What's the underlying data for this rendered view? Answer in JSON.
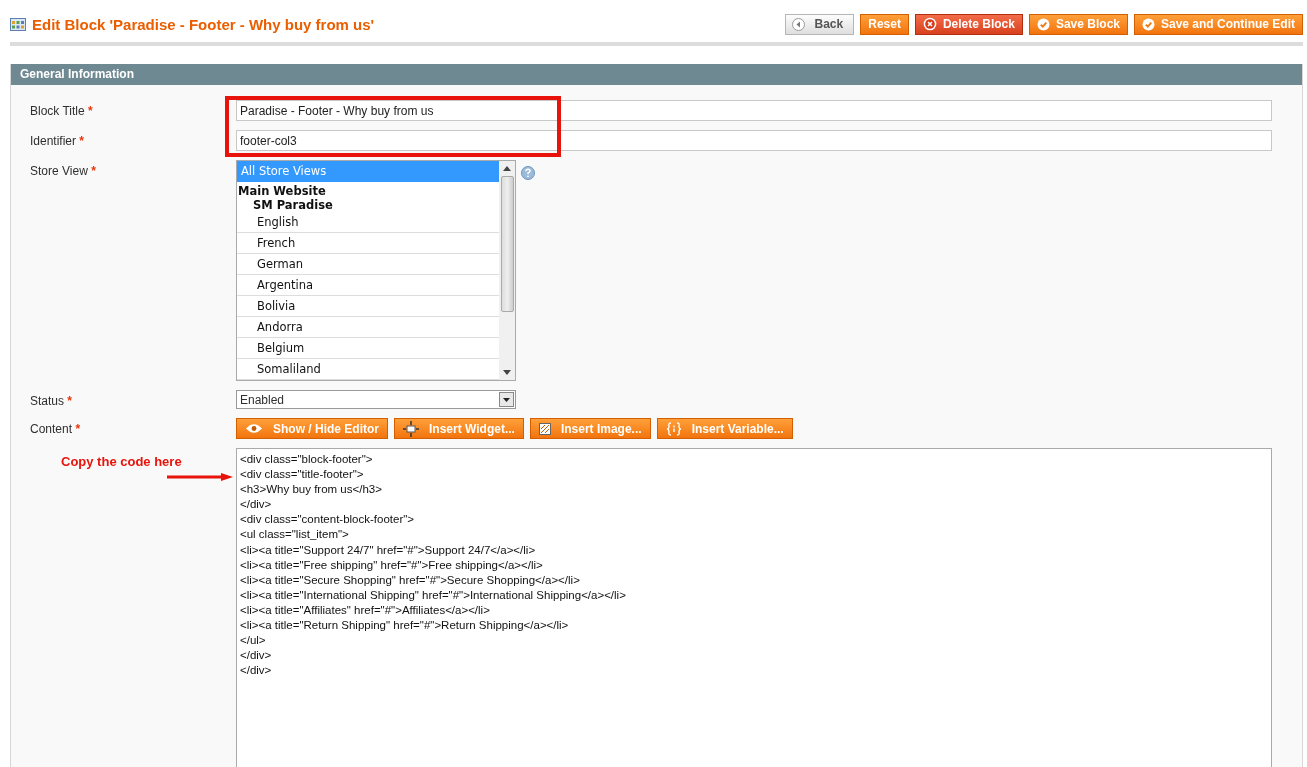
{
  "header": {
    "title": "Edit Block 'Paradise - Footer - Why buy from us'"
  },
  "actions": [
    {
      "label": "Back",
      "kind": "back"
    },
    {
      "label": "Reset",
      "kind": "plain"
    },
    {
      "label": "Delete Block",
      "kind": "delete"
    },
    {
      "label": "Save Block",
      "kind": "save"
    },
    {
      "label": "Save and Continue Edit",
      "kind": "save"
    }
  ],
  "section": {
    "title": "General Information"
  },
  "fields": {
    "block_title": {
      "label": "Block Title",
      "required": "*",
      "value": "Paradise - Footer - Why buy from us"
    },
    "identifier": {
      "label": "Identifier",
      "required": "*",
      "value": "footer-col3"
    },
    "store_view": {
      "label": "Store View",
      "required": "*",
      "options": [
        {
          "label": "All Store Views",
          "kind": "option",
          "selected": true
        },
        {
          "label": "Main Website",
          "kind": "website",
          "selected": false
        },
        {
          "label": "SM Paradise",
          "kind": "store",
          "selected": false
        },
        {
          "label": "English",
          "kind": "option",
          "selected": false
        },
        {
          "label": "French",
          "kind": "option",
          "selected": false
        },
        {
          "label": "German",
          "kind": "option",
          "selected": false
        },
        {
          "label": "Argentina",
          "kind": "option",
          "selected": false
        },
        {
          "label": "Bolivia",
          "kind": "option",
          "selected": false
        },
        {
          "label": "Andorra",
          "kind": "option",
          "selected": false
        },
        {
          "label": "Belgium",
          "kind": "option",
          "selected": false
        },
        {
          "label": "Somaliland",
          "kind": "option",
          "selected": false
        }
      ]
    },
    "status": {
      "label": "Status",
      "required": "*",
      "value": "Enabled"
    },
    "content": {
      "label": "Content",
      "required": "*",
      "buttons": [
        {
          "label": "Show / Hide Editor",
          "kind": "eye"
        },
        {
          "label": "Insert Widget...",
          "kind": "widget"
        },
        {
          "label": "Insert Image...",
          "kind": "image"
        },
        {
          "label": "Insert Variable...",
          "kind": "variable"
        }
      ],
      "lines": [
        "<div class=\"block-footer\">",
        "<div class=\"title-footer\">",
        "<h3>Why buy from us</h3>",
        "</div>",
        "<div class=\"content-block-footer\">",
        "<ul class=\"list_item\">",
        "<li><a title=\"Support 24/7\" href=\"#\">Support 24/7</a></li>",
        "<li><a title=\"Free shipping\" href=\"#\">Free shipping</a></li>",
        "<li><a title=\"Secure Shopping\" href=\"#\">Secure Shopping</a></li>",
        "<li><a title=\"International Shipping\" href=\"#\">International Shipping</a></li>",
        "<li><a title=\"Affiliates\" href=\"#\">Affiliates</a></li>",
        "<li><a title=\"Return Shipping\" href=\"#\">Return Shipping</a></li>",
        "</ul>",
        "</div>",
        "</div>"
      ]
    }
  },
  "annotation": {
    "text": "Copy the code here"
  }
}
